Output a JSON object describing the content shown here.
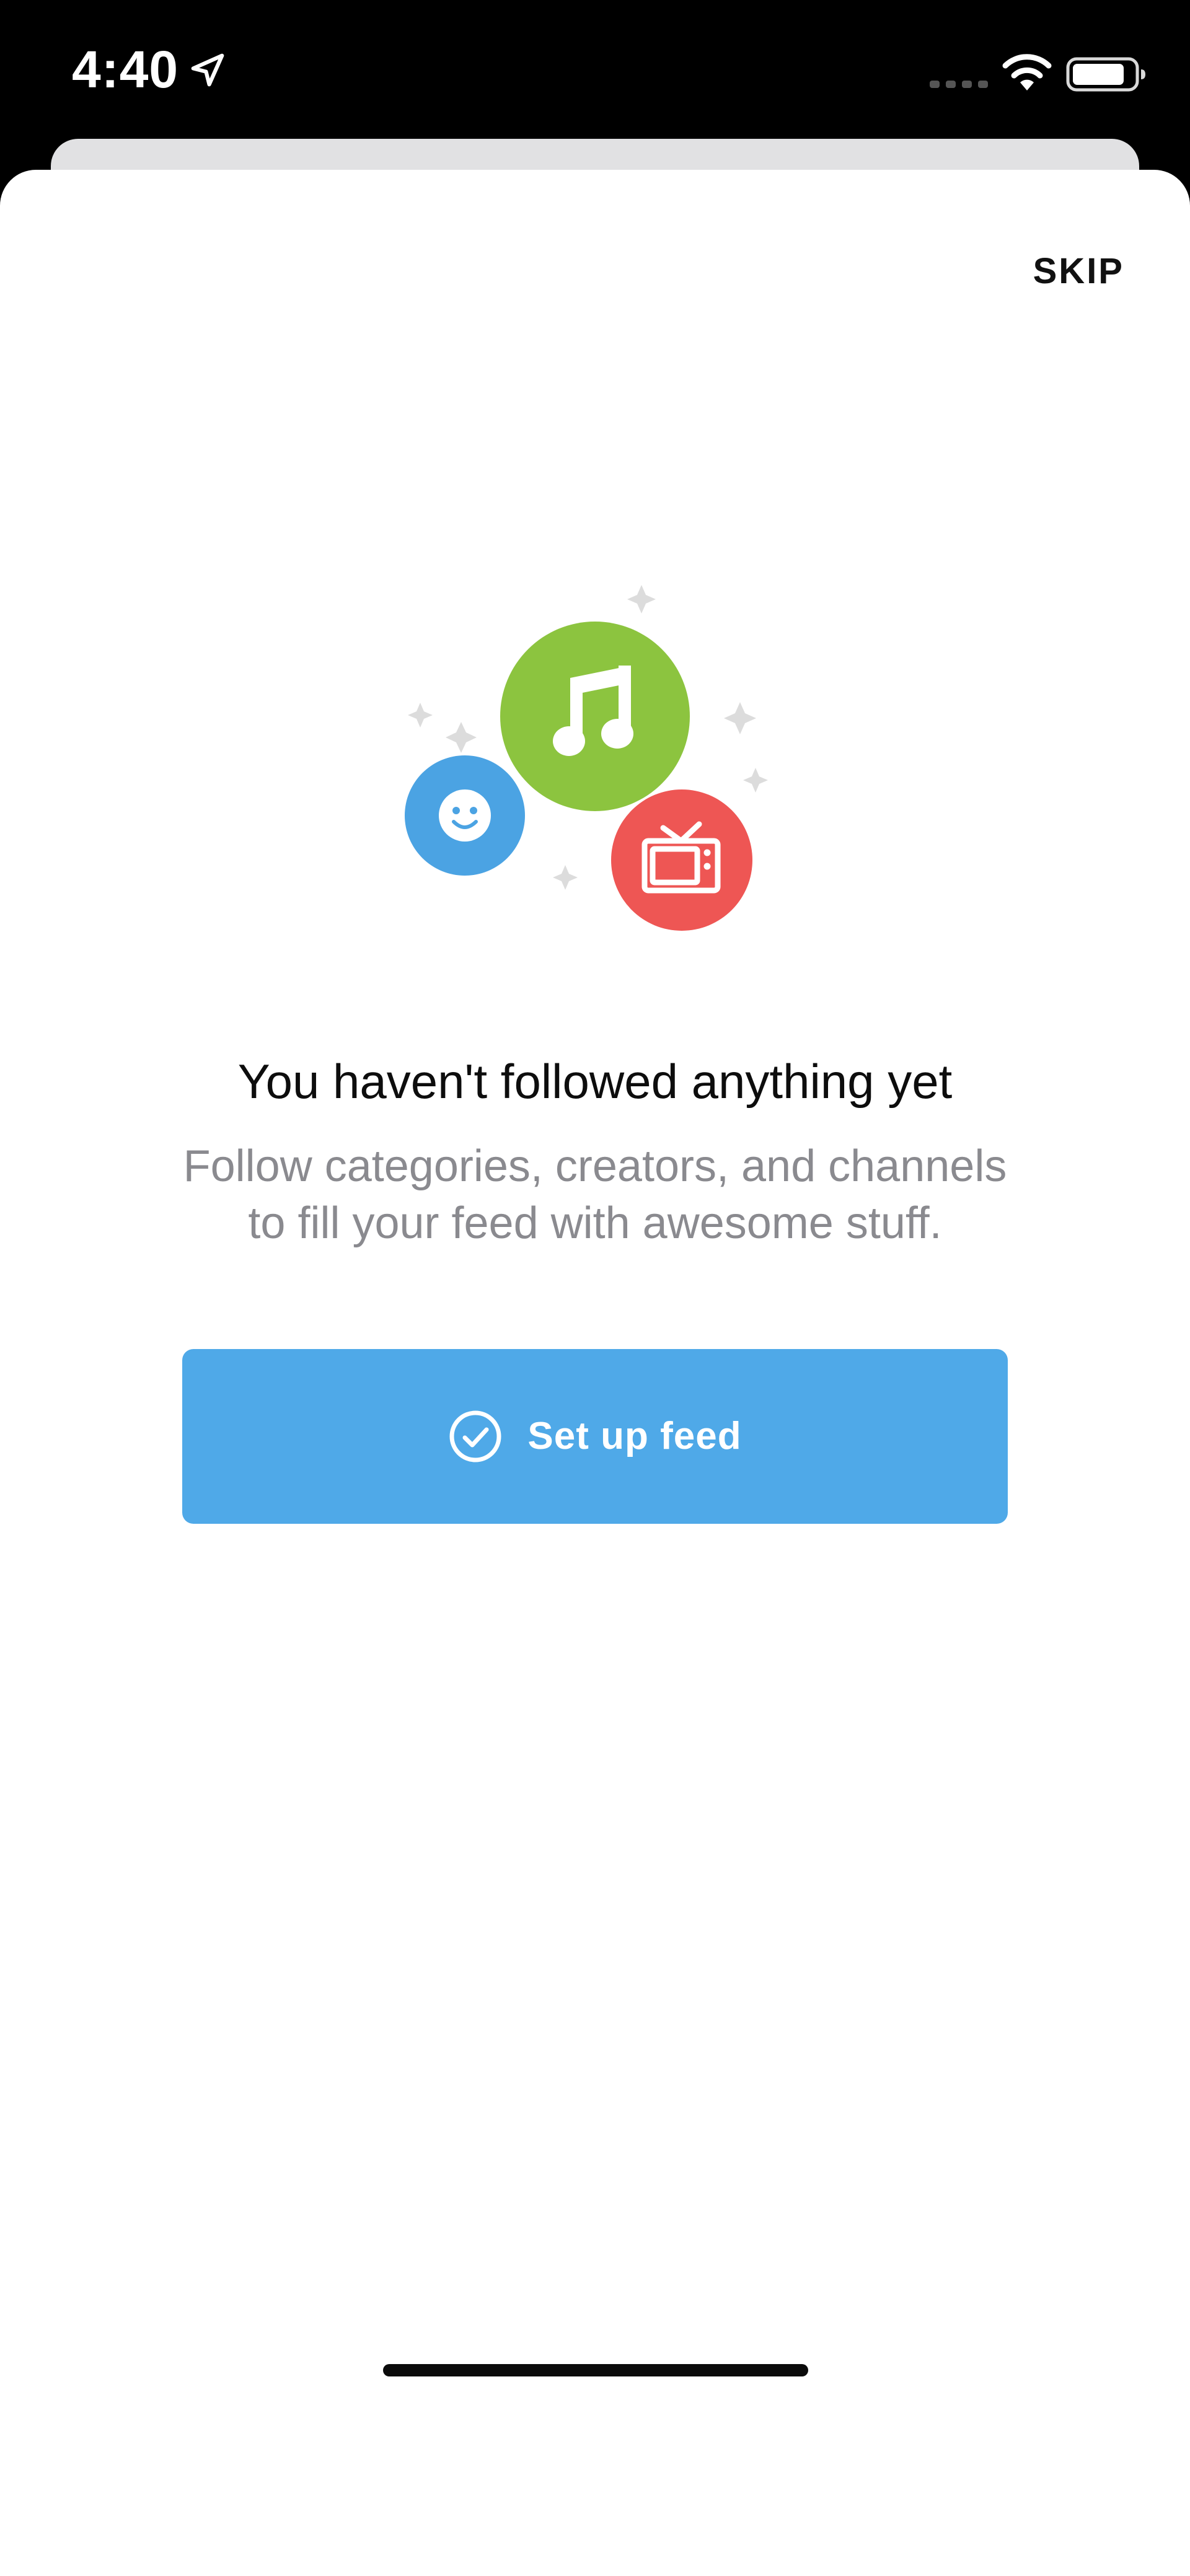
{
  "status_bar": {
    "time": "4:40",
    "icons": [
      "location-arrow-icon",
      "cell-signal-icon",
      "wifi-icon",
      "battery-icon"
    ]
  },
  "header": {
    "skip_label": "SKIP"
  },
  "illustration": {
    "icons": [
      "music-note-icon",
      "face-icon",
      "tv-icon",
      "sparkle-icon"
    ],
    "colors": {
      "music": "#8cc43f",
      "face": "#4ba3e3",
      "tv": "#ee5654",
      "sparkle": "#dcdcdc"
    }
  },
  "empty_state": {
    "title": "You haven't followed anything yet",
    "description_line1": "Follow categories, creators, and channels",
    "description_line2": "to fill your feed with awesome stuff."
  },
  "primary_action": {
    "label": "Set up feed",
    "icon": "check-circle-icon",
    "color": "#4fa9e8"
  }
}
